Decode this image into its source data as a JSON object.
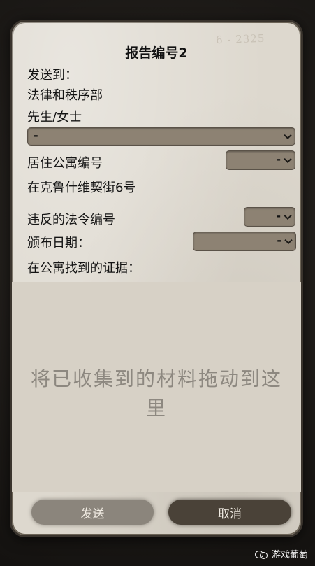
{
  "form": {
    "stamp": "6 - 2325",
    "title": "报告编号2",
    "send_to_label": "发送到：",
    "department": "法律和秩序部",
    "recipient_label": "先生/女士",
    "recipient_value": "-",
    "apartment_label": "居住公寓编号",
    "apartment_value": "-",
    "address": "在克鲁什维契街6号",
    "violation_label": "违反的法令编号",
    "violation_value": "-",
    "issue_date_label": "颁布日期：",
    "issue_date_value": "-",
    "evidence_label": "在公寓找到的证据：",
    "drop_hint": "将已收集到的材料拖动到这里",
    "send_button": "发送",
    "cancel_button": "取消"
  },
  "watermark": {
    "text": "游戏葡萄",
    "icon": "wechat-icon"
  },
  "colors": {
    "paper": "#ddd8ce",
    "select": "#8d8273",
    "send_button": "#8b857c",
    "cancel_button": "#4a4238",
    "hint_text": "#8d8880"
  }
}
